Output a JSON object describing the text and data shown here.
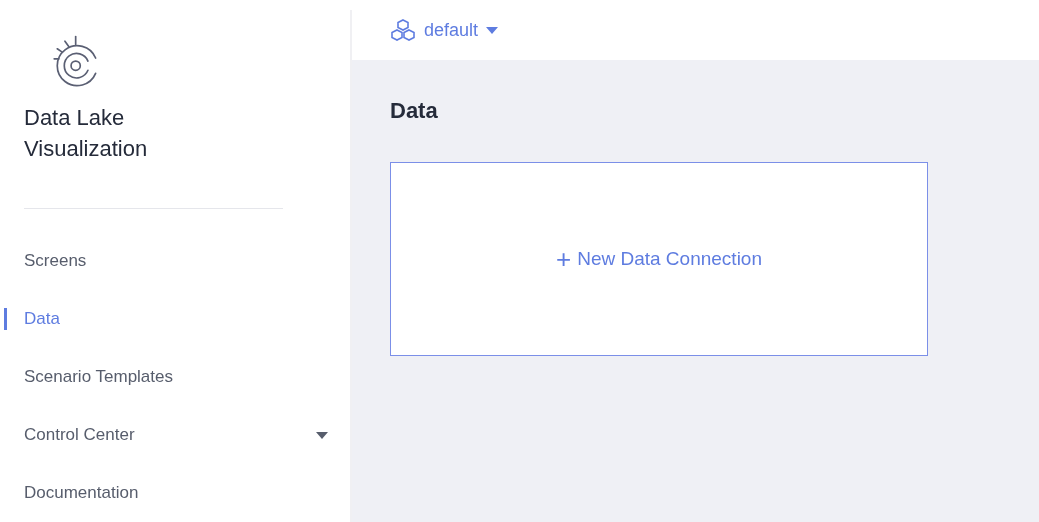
{
  "sidebar": {
    "app_name": "Data Lake Visualization",
    "items": [
      {
        "label": "Screens",
        "selected": false,
        "expandable": false
      },
      {
        "label": "Data",
        "selected": true,
        "expandable": false
      },
      {
        "label": "Scenario Templates",
        "selected": false,
        "expandable": false
      },
      {
        "label": "Control Center",
        "selected": false,
        "expandable": true
      },
      {
        "label": "Documentation",
        "selected": false,
        "expandable": false
      }
    ]
  },
  "workspace": {
    "label": "default"
  },
  "page": {
    "title": "Data",
    "new_connection": {
      "icon": "+",
      "label": "New Data Connection"
    }
  }
}
